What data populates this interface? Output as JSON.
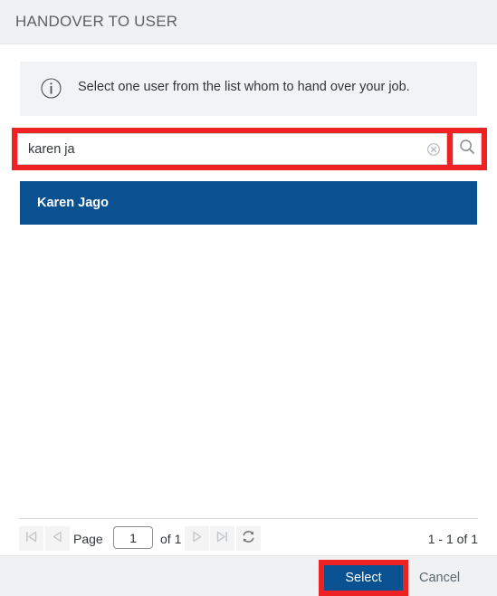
{
  "dialog": {
    "title": "HANDOVER TO USER"
  },
  "info": {
    "icon": "info-circle-icon",
    "message": "Select one user from the list whom to hand over your job."
  },
  "search": {
    "value": "karen ja",
    "placeholder": "",
    "clear_icon": "clear-circle-icon",
    "search_icon": "magnifier-icon",
    "highlight_color": "#ee2222"
  },
  "results": {
    "rows": [
      {
        "label": "Karen Jago",
        "selected": true
      }
    ],
    "selected_color": "#0a5191"
  },
  "pager": {
    "first_icon": "first-page-icon",
    "prev_icon": "previous-page-icon",
    "page_label": "Page",
    "page_value": "1",
    "of_label": "of 1",
    "next_icon": "next-page-icon",
    "last_icon": "last-page-icon",
    "refresh_icon": "refresh-icon",
    "count_text": "1 - 1 of 1"
  },
  "footer": {
    "select_label": "Select",
    "cancel_label": "Cancel",
    "select_color": "#0a5191",
    "highlight_color": "#ee2222"
  }
}
